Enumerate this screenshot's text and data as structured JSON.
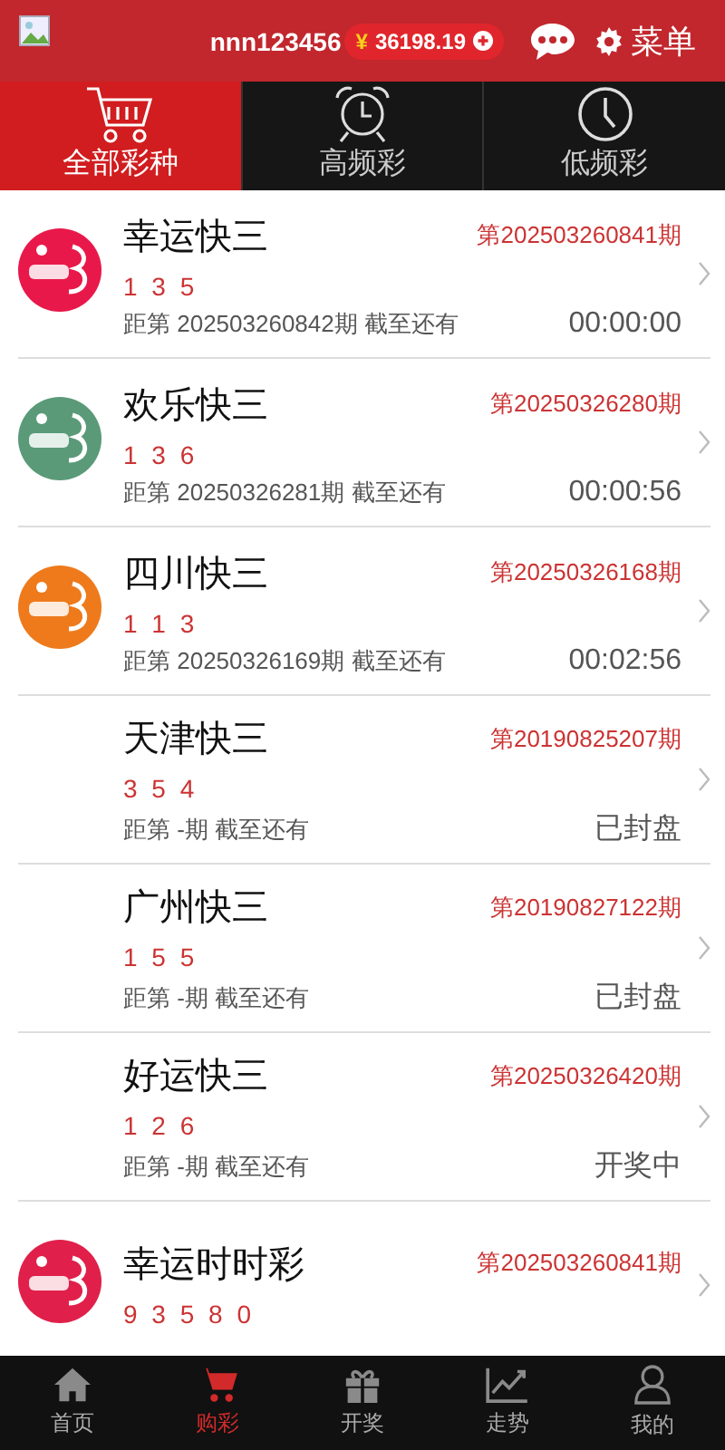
{
  "header": {
    "username": "nnn123456",
    "currency": "¥",
    "balance": "36198.19",
    "menu_label": "菜单"
  },
  "tabs": [
    {
      "label": "全部彩种",
      "selected": true
    },
    {
      "label": "高频彩",
      "selected": false
    },
    {
      "label": "低频彩",
      "selected": false
    }
  ],
  "games": [
    {
      "name": "幸运快三",
      "color": "#e8194a",
      "period": "第202503260841期",
      "numbers": "1 3 5",
      "countdown_label": "距第 202503260842期 截至还有",
      "status": "00:00:00"
    },
    {
      "name": "欢乐快三",
      "color": "#5a9a78",
      "period": "第20250326280期",
      "numbers": "1 3 6",
      "countdown_label": "距第 20250326281期 截至还有",
      "status": "00:00:56"
    },
    {
      "name": "四川快三",
      "color": "#ee7a1c",
      "period": "第20250326168期",
      "numbers": "1 1 3",
      "countdown_label": "距第 20250326169期 截至还有",
      "status": "00:02:56"
    },
    {
      "name": "天津快三",
      "period": "第20190825207期",
      "numbers": "3 5 4",
      "countdown_label": "距第 -期 截至还有",
      "status": "已封盘"
    },
    {
      "name": "广州快三",
      "period": "第20190827122期",
      "numbers": "1 5 5",
      "countdown_label": "距第 -期 截至还有",
      "status": "已封盘"
    },
    {
      "name": "好运快三",
      "period": "第20250326420期",
      "numbers": "1 2 6",
      "countdown_label": "距第 -期 截至还有",
      "status": "开奖中"
    },
    {
      "name": "幸运时时彩",
      "color": "#e0204a",
      "period": "第202503260841期",
      "numbers": "9 3 5 8 0"
    }
  ],
  "bottom_nav": [
    {
      "label": "首页",
      "selected": false
    },
    {
      "label": "购彩",
      "selected": true
    },
    {
      "label": "开奖",
      "selected": false
    },
    {
      "label": "走势",
      "selected": false
    },
    {
      "label": "我的",
      "selected": false
    }
  ]
}
